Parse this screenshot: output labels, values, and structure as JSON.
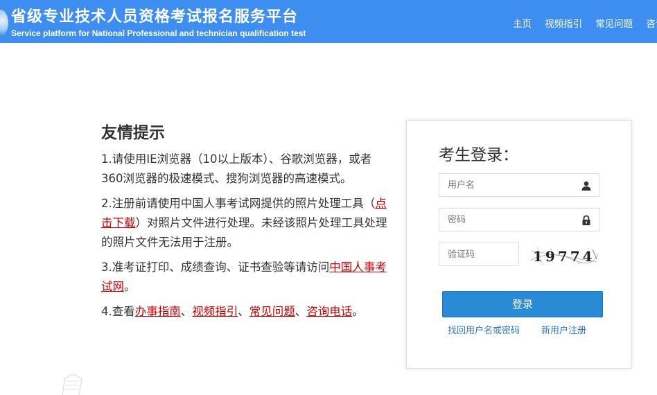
{
  "header": {
    "title": "省级专业技术人员资格考试报名服务平台",
    "subtitle": "Service platform for National Professional and technician qualification test",
    "nav": [
      "主页",
      "视频指引",
      "常见问题",
      "咨询"
    ]
  },
  "tips": {
    "title": "友情提示",
    "items": [
      {
        "parts": [
          {
            "text": "1.请使用IE浏览器（10以上版本）、谷歌浏览器，或者360浏览器的极速模式、搜狗浏览器的高速模式。"
          }
        ]
      },
      {
        "parts": [
          {
            "text": "2.注册前请使用中国人事考试网提供的照片处理工具（"
          },
          {
            "text": "点击下载",
            "link": true
          },
          {
            "text": "）对照片文件进行处理。未经该照片处理工具处理的照片文件无法用于注册。"
          }
        ]
      },
      {
        "parts": [
          {
            "text": "3.准考证打印、成绩查询、证书查验等请访问"
          },
          {
            "text": "中国人事考试网",
            "link": true
          },
          {
            "text": "。"
          }
        ]
      },
      {
        "parts": [
          {
            "text": "4.查看"
          },
          {
            "text": "办事指南",
            "link": true
          },
          {
            "text": "、"
          },
          {
            "text": "视频指引",
            "link": true
          },
          {
            "text": "、"
          },
          {
            "text": "常见问题",
            "link": true
          },
          {
            "text": "、"
          },
          {
            "text": "咨询电话",
            "link": true
          },
          {
            "text": "。"
          }
        ]
      }
    ]
  },
  "login": {
    "title": "考生登录：",
    "username_placeholder": "用户名",
    "password_placeholder": "密码",
    "captcha_placeholder": "验证码",
    "captcha_text": "19774",
    "submit_label": "登录",
    "forgot_label": "找回用户名或密码",
    "register_label": "新用户注册",
    "username_icon": "user-icon",
    "password_icon": "lock-icon"
  },
  "colors": {
    "header_bg": "#3d8ef0",
    "link_red": "#cc0000",
    "button_blue": "#2b8ad6",
    "link_blue": "#2b78c4"
  }
}
